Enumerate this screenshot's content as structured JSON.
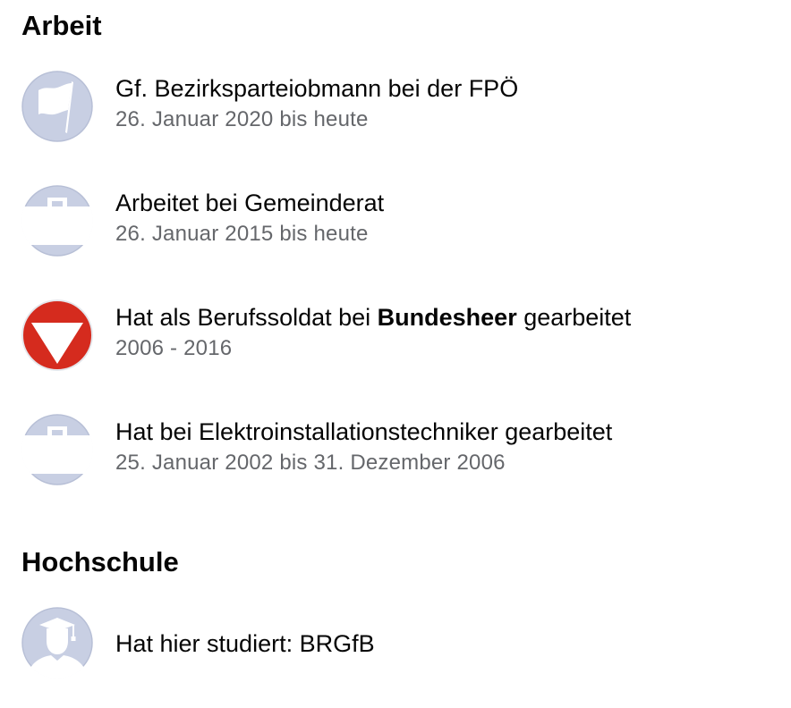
{
  "sections": {
    "work": {
      "title": "Arbeit",
      "items": [
        {
          "title": "Gf. Bezirksparteiobmann bei der FPÖ",
          "subtitle": "26. Januar 2020 bis heute",
          "icon": "flag-icon"
        },
        {
          "title": "Arbeitet bei Gemeinderat",
          "subtitle": "26. Januar 2015 bis heute",
          "icon": "briefcase-icon"
        },
        {
          "title_prefix": "Hat als Berufssoldat bei ",
          "title_bold": "Bundesheer",
          "title_suffix": " gearbeitet",
          "subtitle": "2006 - 2016",
          "icon": "bundesheer-logo-icon"
        },
        {
          "title": "Hat bei Elektroinstallationstechniker gearbeitet",
          "subtitle": "25. Januar 2002 bis 31. Dezember 2006",
          "icon": "briefcase-icon"
        }
      ]
    },
    "education": {
      "title": "Hochschule",
      "items": [
        {
          "title": "Hat hier studiert: BRGfB",
          "icon": "graduate-icon"
        }
      ]
    }
  },
  "colors": {
    "placeholder_bg": "#c8cfe3",
    "placeholder_fg": "#ffffff",
    "bundesheer_red": "#d52b1e",
    "subtitle": "#65676b",
    "text": "#050505"
  }
}
